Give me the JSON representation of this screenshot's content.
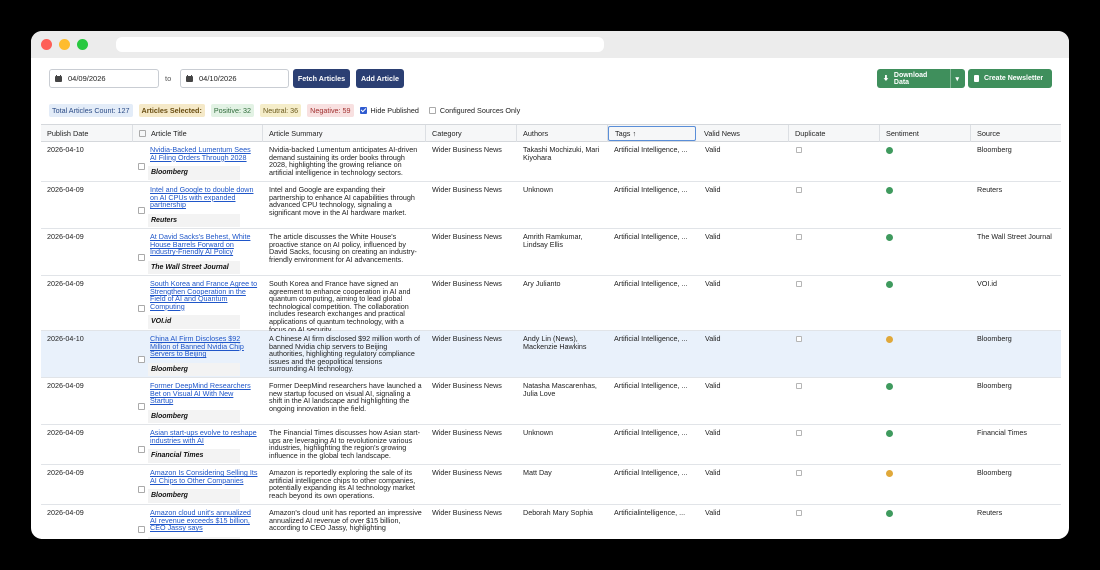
{
  "toolbar": {
    "date_from": "04/09/2026",
    "to_label": "to",
    "date_to": "04/10/2026",
    "fetch_label": "Fetch Articles",
    "add_label": "Add Article",
    "download_label": "Download Data",
    "newsletter_label": "Create Newsletter"
  },
  "stats": {
    "total": "Total Articles Count: 127",
    "selected": "Articles Selected:",
    "positive": "Positive: 32",
    "neutral": "Neutral: 36",
    "negative": "Negative: 59",
    "hide_published": "Hide Published",
    "configured_only": "Configured Sources Only"
  },
  "columns": {
    "publish_date": "Publish Date",
    "title": "Article Title",
    "summary": "Article Summary",
    "category": "Category",
    "authors": "Authors",
    "tags": "Tags ↑",
    "valid": "Valid News",
    "duplicate": "Duplicate",
    "sentiment": "Sentiment",
    "source": "Source"
  },
  "colors": {
    "positive": "#3f9a5e",
    "neutral": "#e0a83a",
    "accent": "#2b3f73",
    "green_button": "#3f8f5c"
  },
  "rows": [
    {
      "date": "2026-04-10",
      "title": "Nvidia-Backed Lumentum Sees AI Filing Orders Through 2028",
      "source_chip": "Bloomberg",
      "summary": "Nvidia-backed Lumentum anticipates AI-driven demand sustaining its order books through 2028, highlighting the growing reliance on artificial intelligence in technology sectors.",
      "category": "Wider Business News",
      "authors": "Takashi Mochizuki, Mari Kiyohara",
      "tags": "Artificial Intelligence, ...",
      "valid": "Valid",
      "sentiment": "positive",
      "source": "Bloomberg"
    },
    {
      "date": "2026-04-09",
      "title": "Intel and Google to double down on AI CPUs with expanded partnership",
      "source_chip": "Reuters",
      "summary": "Intel and Google are expanding their partnership to enhance AI capabilities through advanced CPU technology, signaling a significant move in the AI hardware market.",
      "category": "Wider Business News",
      "authors": "Unknown",
      "tags": "Artificial Intelligence, ...",
      "valid": "Valid",
      "sentiment": "positive",
      "source": "Reuters"
    },
    {
      "date": "2026-04-09",
      "title": "At David Sacks's Behest, White House Barrels Forward on Industry-Friendly AI Policy",
      "source_chip": "The Wall Street Journal",
      "summary": "The article discusses the White House's proactive stance on AI policy, influenced by David Sacks, focusing on creating an industry-friendly environment for AI advancements.",
      "category": "Wider Business News",
      "authors": "Amrith Ramkumar, Lindsay Ellis",
      "tags": "Artificial Intelligence, ...",
      "valid": "Valid",
      "sentiment": "positive",
      "source": "The Wall Street Journal"
    },
    {
      "date": "2026-04-09",
      "title": "South Korea and France Agree to Strengthen Cooperation in the Field of AI and Quantum Computing",
      "source_chip": "VOI.id",
      "summary": "South Korea and France have signed an agreement to enhance cooperation in AI and quantum computing, aiming to lead global technological competition. The collaboration includes research exchanges and practical applications of quantum technology, with a focus on AI security.",
      "category": "Wider Business News",
      "authors": "Ary Julianto",
      "tags": "Artificial Intelligence, ...",
      "valid": "Valid",
      "sentiment": "positive",
      "source": "VOI.id"
    },
    {
      "date": "2026-04-10",
      "title": "China AI Firm Discloses $92 Million of Banned Nvidia Chip Servers to Beijing",
      "source_chip": "Bloomberg",
      "summary": "A Chinese AI firm disclosed $92 million worth of banned Nvidia chip servers to Beijing authorities, highlighting regulatory compliance issues and the geopolitical tensions surrounding AI technology.",
      "category": "Wider Business News",
      "authors": "Andy Lin (News), Mackenzie Hawkins",
      "tags": "Artificial Intelligence, ...",
      "valid": "Valid",
      "sentiment": "neutral",
      "source": "Bloomberg"
    },
    {
      "date": "2026-04-09",
      "title": "Former DeepMind Researchers Bet on Visual AI With New Startup",
      "source_chip": "Bloomberg",
      "summary": "Former DeepMind researchers have launched a new startup focused on visual AI, signaling a shift in the AI landscape and highlighting the ongoing innovation in the field.",
      "category": "Wider Business News",
      "authors": "Natasha Mascarenhas, Julia Love",
      "tags": "Artificial Intelligence, ...",
      "valid": "Valid",
      "sentiment": "positive",
      "source": "Bloomberg"
    },
    {
      "date": "2026-04-09",
      "title": "Asian start-ups evolve to reshape industries with AI",
      "source_chip": "Financial Times",
      "summary": "The Financial Times discusses how Asian start-ups are leveraging AI to revolutionize various industries, highlighting the region's growing influence in the global tech landscape.",
      "category": "Wider Business News",
      "authors": "Unknown",
      "tags": "Artificial Intelligence, ...",
      "valid": "Valid",
      "sentiment": "positive",
      "source": "Financial Times"
    },
    {
      "date": "2026-04-09",
      "title": "Amazon Is Considering Selling Its AI Chips to Other Companies",
      "source_chip": "Bloomberg",
      "summary": "Amazon is reportedly exploring the sale of its artificial intelligence chips to other companies, potentially expanding its AI technology market reach beyond its own operations.",
      "category": "Wider Business News",
      "authors": "Matt Day",
      "tags": "Artificial Intelligence, ...",
      "valid": "Valid",
      "sentiment": "neutral",
      "source": "Bloomberg"
    },
    {
      "date": "2026-04-09",
      "title": "Amazon cloud unit's annualized AI revenue exceeds $15 billion, CEO Jassy says",
      "source_chip": "Reuters",
      "summary": "Amazon's cloud unit has reported an impressive annualized AI revenue of over $15 billion, according to CEO Jassy, highlighting",
      "category": "Wider Business News",
      "authors": "Deborah Mary Sophia",
      "tags": "Artificialintelligence, ...",
      "valid": "Valid",
      "sentiment": "positive",
      "source": "Reuters"
    }
  ]
}
